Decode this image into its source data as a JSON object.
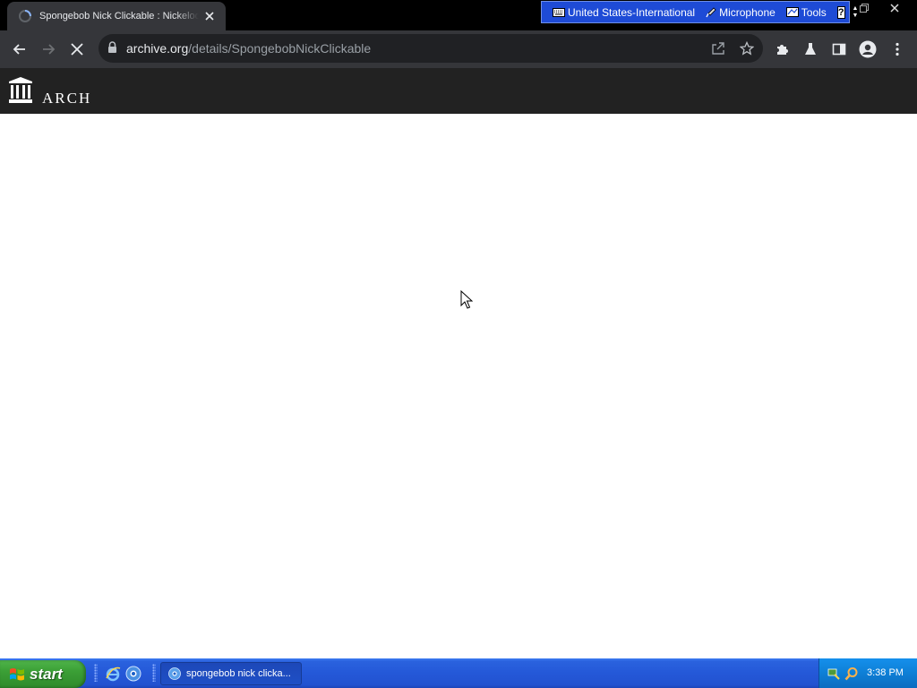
{
  "browser": {
    "tab": {
      "title": "Spongebob Nick Clickable : Nickelodeon"
    },
    "address": {
      "host": "archive.org",
      "path": "/details/SpongebobNickClickable"
    }
  },
  "language_bar": {
    "language": "United States-International",
    "microphone": "Microphone",
    "tools": "Tools",
    "help": "?"
  },
  "site": {
    "name": "ARCH"
  },
  "taskbar": {
    "start_label": "start",
    "task_label": "spongebob nick clicka...",
    "clock": "3:38 PM"
  },
  "colors": {
    "taskbar_blue": "#2458d8",
    "start_green": "#3b9f36",
    "chrome_dark": "#35363a",
    "site_header": "#222222"
  }
}
